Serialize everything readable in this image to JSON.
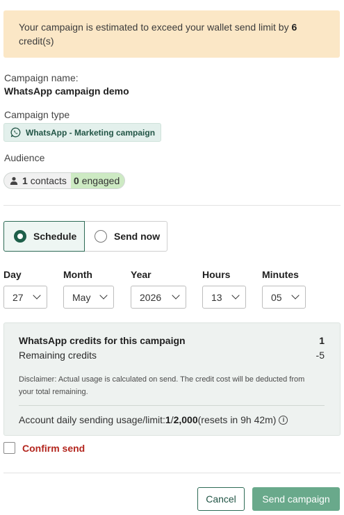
{
  "warning": {
    "text_before": "Your campaign is estimated to exceed your wallet send limit by ",
    "amount": "6",
    "text_after": " credit(s)",
    "background": "#fbe7c6"
  },
  "campaign": {
    "name_label": "Campaign name:",
    "name": "WhatsApp campaign demo",
    "type_label": "Campaign type",
    "type_icon": "whatsapp-icon",
    "type": "WhatsApp - Marketing campaign",
    "audience_label": "Audience",
    "audience_icon": "person-icon",
    "contacts_count": "1",
    "contacts_label": "contacts",
    "engaged_count": "0",
    "engaged_label": "engaged"
  },
  "send_mode": {
    "options": [
      {
        "label": "Schedule",
        "selected": true
      },
      {
        "label": "Send now",
        "selected": false
      }
    ]
  },
  "schedule": {
    "fields": [
      {
        "label": "Day",
        "value": "27"
      },
      {
        "label": "Month",
        "value": "May"
      },
      {
        "label": "Year",
        "value": "2026"
      },
      {
        "label": "Hours",
        "value": "13"
      },
      {
        "label": "Minutes",
        "value": "05"
      }
    ]
  },
  "credits": {
    "title": "WhatsApp credits for this campaign",
    "title_value": "1",
    "remaining_label": "Remaining credits",
    "remaining_value": "-5",
    "disclaimer": "Disclaimer: Actual usage is calculated on send. The credit cost will be deducted from your total remaining.",
    "usage_label": "Account daily sending usage/limit: ",
    "usage_used": "1",
    "usage_sep": " / ",
    "usage_limit": "2,000",
    "usage_reset": " (resets in 9h 42m)",
    "info_icon": "info-icon"
  },
  "confirm": {
    "label": "Confirm send",
    "checked": false,
    "color": "#b3261e"
  },
  "actions": {
    "cancel": "Cancel",
    "send": "Send campaign"
  },
  "colors": {
    "accent": "#1e5f4a",
    "send_button": "#69a98b"
  }
}
